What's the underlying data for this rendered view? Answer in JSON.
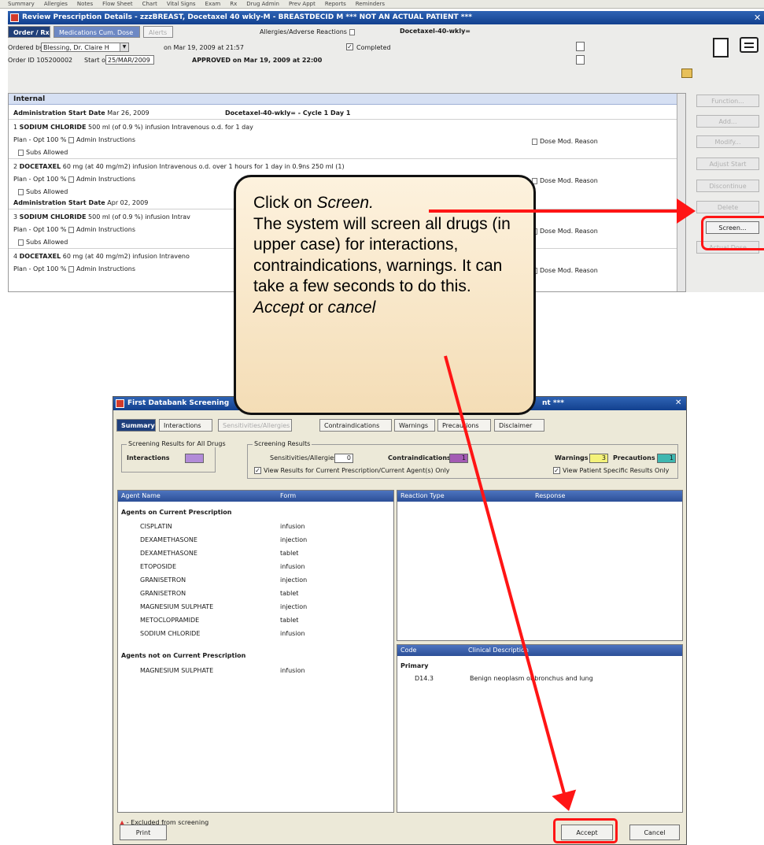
{
  "top_menu": [
    "Summary",
    "Allergies",
    "Notes",
    "Flow Sheet",
    "Chart",
    "Vital Signs",
    "Exam",
    "Rx",
    "Drug Admin",
    "Prev Appt",
    "Reports",
    "Reminders"
  ],
  "top_window": {
    "title": "Review Prescription Details - zzzBREAST, Docetaxel 40 wkly-M - BREASTDECID M *** NOT AN ACTUAL PATIENT ***",
    "tabs": [
      "Order / Rx",
      "Medications Cum. Dose",
      "Alerts"
    ],
    "allergies_label": "Allergies/Adverse Reactions",
    "regimen_label": "Docetaxel-40-wkly=",
    "ordered_by_label": "Ordered by",
    "ordered_by_value": "Blessing, Dr. Claire H",
    "ordered_on": "on Mar 19, 2009 at 21:57",
    "completed_label": "Completed",
    "order_id_label": "Order ID 105200002",
    "start_on_label": "Start on",
    "start_on_value": "25/MAR/2009",
    "approved_text": "APPROVED on Mar 19, 2009 at 22:00"
  },
  "order_panel": {
    "header": "Internal",
    "admin1_label": "Administration Start Date",
    "admin1_date": "Mar 26, 2009",
    "admin1_cycle": "Docetaxel-40-wkly= - Cycle 1 Day 1",
    "item1_title": "SODIUM CHLORIDE",
    "item1_detail": "500 ml (of 0.9 %) infusion Intravenous o.d. for 1 day",
    "plan_text": "Plan - Opt   100 %",
    "admin_instructions": "Admin Instructions",
    "subs_allowed": "Subs Allowed",
    "dose_mod": "Dose Mod. Reason",
    "item2_title": "DOCETAXEL",
    "item2_detail": "60 mg (at 40 mg/m2) infusion Intravenous o.d. over 1 hours for 1 day in 0.9ns 250 ml (1)",
    "admin2_label": "Administration Start Date",
    "admin2_date": "Apr 02, 2009",
    "item3_title": "SODIUM CHLORIDE",
    "item3_detail": "500 ml (of 0.9 %) infusion Intrav",
    "item4_title": "DOCETAXEL",
    "item4_detail": "60 mg (at 40 mg/m2) infusion Intraveno"
  },
  "side_buttons": [
    "Function...",
    "Add...",
    "Modify...",
    "Adjust Start",
    "Discontinue",
    "Delete",
    "Screen...",
    "Actual Dose"
  ],
  "callout": {
    "line1_prefix": "Click on ",
    "line1_italic": "Screen.",
    "body": "The system will screen all drugs (in upper case) for interactions, contraindications, warnings. It can take a few seconds to do this.",
    "accept_italic": "Accept",
    "or_text": " or ",
    "cancel_italic": "cancel"
  },
  "dialog": {
    "title": "First Databank Screening",
    "title_suffix": "nt ***",
    "tabs": [
      "Summary",
      "Interactions",
      "Sensitivities/Allergies",
      "Contraindications",
      "Warnings",
      "Precautions",
      "Disclaimer"
    ],
    "all_drugs_group": "Screening Results for All Drugs",
    "interactions_label": "Interactions",
    "screening_group": "Screening Results",
    "sensitivities_label": "Sensitivities/Allergies",
    "sensitivities_count": "0",
    "contraindications_label": "Contraindications",
    "contraindications_count": "1",
    "warnings_label": "Warnings",
    "warnings_count": "3",
    "precautions_label": "Precautions",
    "precautions_count": "1",
    "view_current_label": "View Results for Current Prescription/Current Agent(s) Only",
    "view_patient_label": "View Patient Specific Results Only",
    "agents_header": [
      "Agent Name",
      "Form"
    ],
    "current_group": "Agents on Current Prescription",
    "current_agents": [
      {
        "name": "CISPLATIN",
        "form": "infusion"
      },
      {
        "name": "DEXAMETHASONE",
        "form": "injection"
      },
      {
        "name": "DEXAMETHASONE",
        "form": "tablet"
      },
      {
        "name": "ETOPOSIDE",
        "form": "infusion"
      },
      {
        "name": "GRANISETRON",
        "form": "injection"
      },
      {
        "name": "GRANISETRON",
        "form": "tablet"
      },
      {
        "name": "MAGNESIUM SULPHATE",
        "form": "injection"
      },
      {
        "name": "METOCLOPRAMIDE",
        "form": "tablet"
      },
      {
        "name": "SODIUM CHLORIDE",
        "form": "infusion"
      }
    ],
    "not_current_group": "Agents not on Current Prescription",
    "not_current_agents": [
      {
        "name": "MAGNESIUM SULPHATE",
        "form": "infusion"
      }
    ],
    "reaction_header": [
      "Reaction Type",
      "Response"
    ],
    "code_header": [
      "Code",
      "Clinical Description"
    ],
    "code_group": "Primary",
    "code_row": {
      "code": "D14.3",
      "desc": "Benign neoplasm of bronchus and lung"
    },
    "excluded_note": "- Excluded from screening",
    "print_button": "Print",
    "accept_button": "Accept",
    "cancel_button": "Cancel"
  },
  "colors": {
    "interactions": "#b28bd8",
    "contraindications": "#a35bb4",
    "warnings": "#f4f27a",
    "precautions": "#3fb7b0",
    "arrow": "#ff1515",
    "callout_fill": "#f6e3c2"
  }
}
